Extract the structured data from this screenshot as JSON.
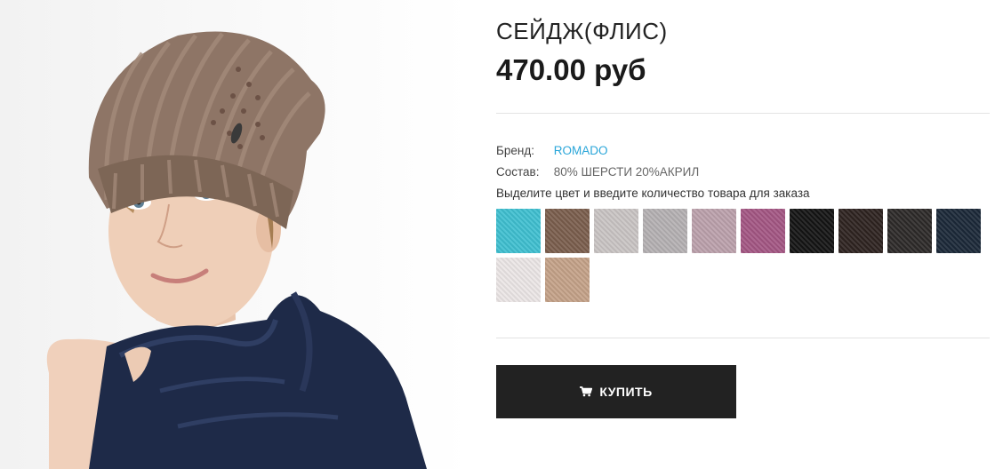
{
  "product": {
    "title": "СЕЙДЖ(ФЛИС)",
    "price": "470.00 руб"
  },
  "attributes": {
    "brand_label": "Бренд:",
    "brand_value": "ROMADO",
    "composition_label": "Состав:",
    "composition_value": "80% ШЕРСТИ 20%АКРИЛ"
  },
  "color_hint": "Выделите цвет и введите количество товара для заказа",
  "swatches": [
    {
      "color": "#3fbfd0"
    },
    {
      "color": "#7a5e4d"
    },
    {
      "color": "#c9c4c3"
    },
    {
      "color": "#b4b0b2"
    },
    {
      "color": "#bba0ab"
    },
    {
      "color": "#a35683"
    },
    {
      "color": "#141414"
    },
    {
      "color": "#2e2320"
    },
    {
      "color": "#2c2928"
    },
    {
      "color": "#1b2838"
    },
    {
      "color": "#ebe6e5"
    },
    {
      "color": "#c4a288"
    }
  ],
  "buy_button": {
    "label": "КУПИТЬ",
    "icon": "cart-icon"
  },
  "colors": {
    "brand_link": "#2aa6d9",
    "button_bg": "#222222"
  }
}
